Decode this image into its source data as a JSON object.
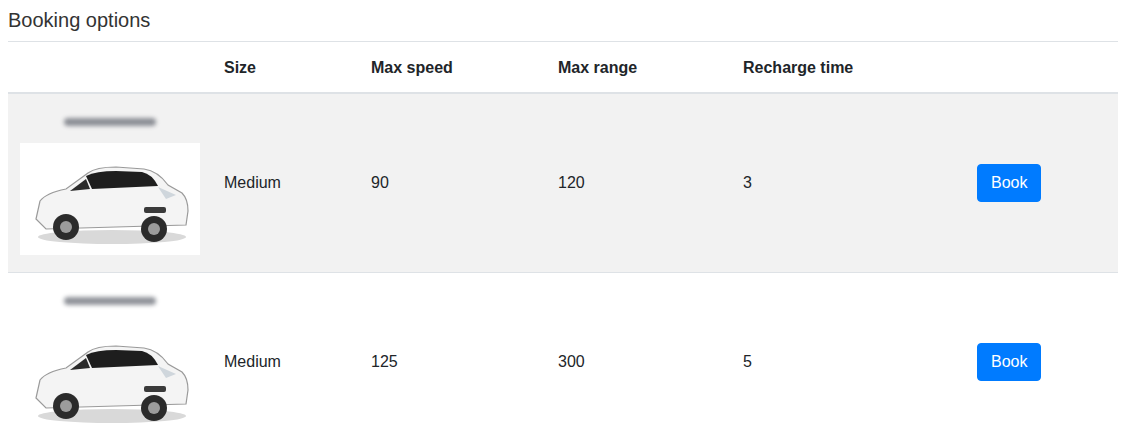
{
  "section": {
    "title": "Booking options"
  },
  "table": {
    "columns": [
      "",
      "Size",
      "Max speed",
      "Max range",
      "Recharge time",
      ""
    ],
    "rows": [
      {
        "size": "Medium",
        "max_speed": "90",
        "max_range": "120",
        "recharge_time": "3",
        "action": "Book",
        "selected": true
      },
      {
        "size": "Medium",
        "max_speed": "125",
        "max_range": "300",
        "recharge_time": "5",
        "action": "Book",
        "selected": false
      }
    ]
  }
}
